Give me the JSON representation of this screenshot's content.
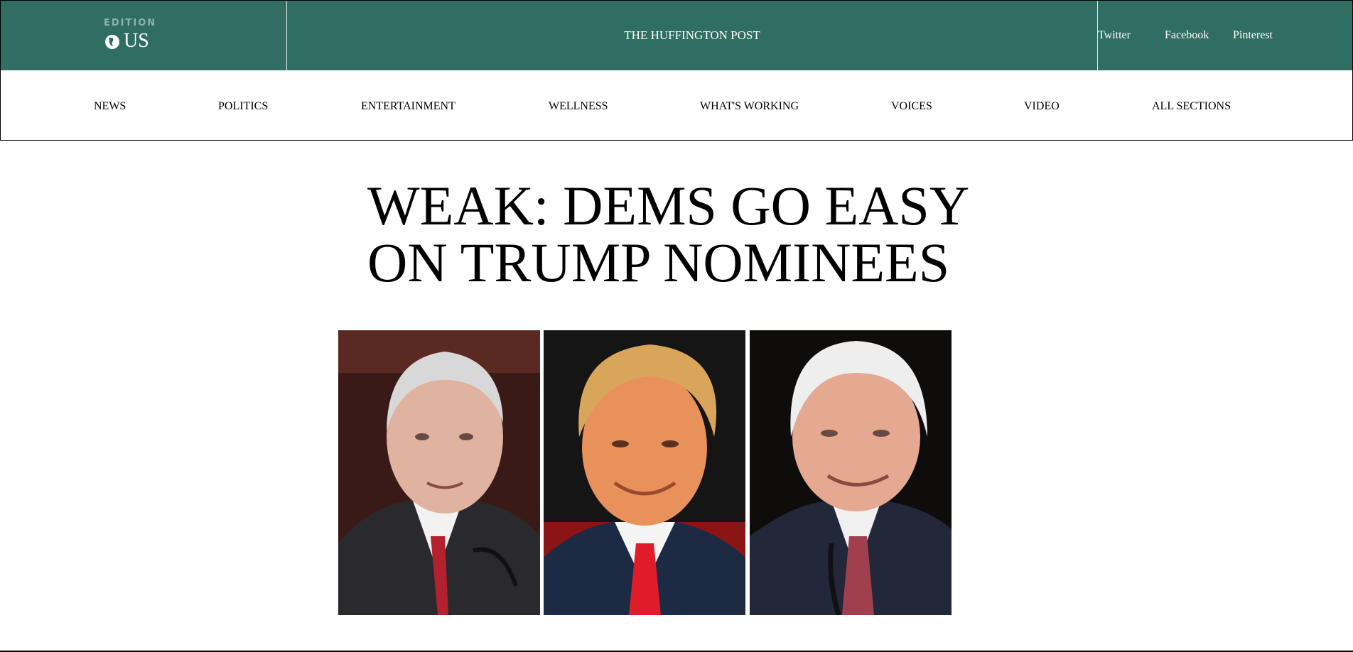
{
  "header": {
    "edition_label": "EDITION",
    "edition_value": "US",
    "site_title": "THE HUFFINGTON POST",
    "social": [
      "Twitter",
      "Facebook",
      "Pinterest"
    ],
    "colors": {
      "brand_green": "#306e63",
      "text_light": "#ffffff"
    }
  },
  "nav": {
    "items": [
      "NEWS",
      "POLITICS",
      "ENTERTAINMENT",
      "WELLNESS",
      "WHAT'S WORKING",
      "VOICES",
      "VIDEO",
      "ALL SECTIONS"
    ]
  },
  "article": {
    "headline_line1": "WEAK: DEMS GO EASY",
    "headline_line2": "ON TRUMP NOMINEES"
  }
}
